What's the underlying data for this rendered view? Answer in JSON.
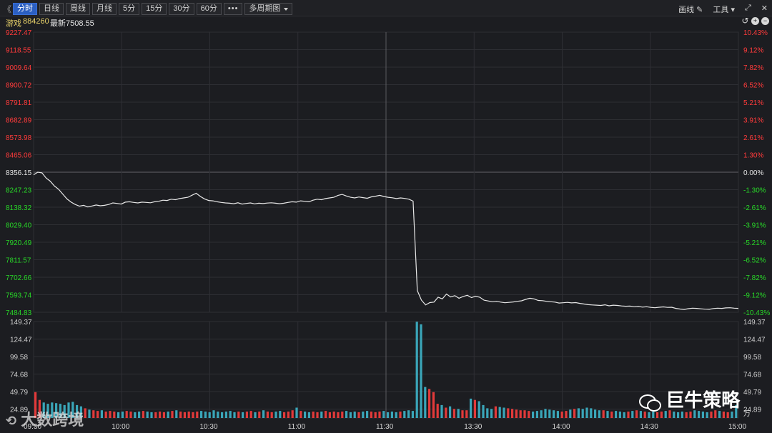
{
  "toolbar": {
    "nav_back": "《",
    "periods": [
      {
        "label": "分时",
        "active": true
      },
      {
        "label": "日线",
        "active": false
      },
      {
        "label": "周线",
        "active": false
      },
      {
        "label": "月线",
        "active": false
      },
      {
        "label": "5分",
        "active": false
      },
      {
        "label": "15分",
        "active": false
      },
      {
        "label": "30分",
        "active": false
      },
      {
        "label": "60分",
        "active": false
      }
    ],
    "more": "•••",
    "multi_period": "多周期图",
    "draw_line": "画线",
    "tools": "工具",
    "fullscreen_icon": "expand-icon",
    "close_icon": "close-icon"
  },
  "info": {
    "name": "游戏",
    "code": "884260",
    "latest": "最新7508.55"
  },
  "colors": {
    "up": "#ff3b3b",
    "down": "#28d728",
    "flat": "#e6e6e6",
    "vol_up": "#e23a3a",
    "vol_down": "#3aa6b9",
    "grid": "#2e2f34"
  },
  "price_axis": {
    "labels": [
      "9227.47",
      "9118.55",
      "9009.64",
      "8900.72",
      "8791.81",
      "8682.89",
      "8573.98",
      "8465.06",
      "8356.15",
      "8247.23",
      "8138.32",
      "8029.40",
      "7920.49",
      "7811.57",
      "7702.66",
      "7593.74",
      "7484.83"
    ],
    "pct_labels": [
      "10.43%",
      "9.12%",
      "7.82%",
      "6.52%",
      "5.21%",
      "3.91%",
      "2.61%",
      "1.30%",
      "0.00%",
      "-1.30%",
      "-2.61%",
      "-3.91%",
      "-5.21%",
      "-6.52%",
      "-7.82%",
      "-9.12%",
      "-10.43%"
    ],
    "mid_index": 8
  },
  "volume_axis": {
    "labels": [
      "149.37",
      "124.47",
      "99.58",
      "74.68",
      "49.79",
      "24.89"
    ],
    "unit": "万"
  },
  "time_axis": [
    "09:30",
    "10:00",
    "10:30",
    "11:00",
    "11:30",
    "13:30",
    "14:00",
    "14:30",
    "15:00"
  ],
  "watermarks": {
    "left": "大数跨境",
    "right": "巨牛策略"
  },
  "chart_data": {
    "type": "line",
    "x": [
      "09:30",
      "10:00",
      "10:30",
      "11:00",
      "11:30",
      "13:30",
      "14:00",
      "14:30",
      "15:00"
    ],
    "ylim": [
      7484.83,
      9227.47
    ],
    "base": 8356.15,
    "series": [
      {
        "values": [
          8340,
          8356,
          8352,
          8320,
          8300,
          8270,
          8250,
          8220,
          8190,
          8170,
          8155,
          8145,
          8150,
          8140,
          8146,
          8152,
          8147,
          8150,
          8155,
          8165,
          8162,
          8158,
          8170,
          8172,
          8168,
          8165,
          8170,
          8168,
          8166,
          8172,
          8175,
          8182,
          8180,
          8188,
          8185,
          8192,
          8196,
          8200,
          8213,
          8225,
          8205,
          8190,
          8180,
          8178,
          8172,
          8168,
          8165,
          8163,
          8160,
          8166,
          8158,
          8162,
          8165,
          8159,
          8163,
          8161,
          8164,
          8166,
          8163,
          8160,
          8163,
          8168,
          8172,
          8170,
          8178,
          8175,
          8172,
          8182,
          8188,
          8185,
          8192,
          8196,
          8200,
          8212,
          8218,
          8208,
          8200,
          8196,
          8202,
          8198,
          8194,
          8203,
          8207,
          8212,
          8205,
          8200,
          8197,
          8192,
          8196,
          8193,
          8188,
          8176,
          7620,
          7560,
          7530,
          7545,
          7548,
          7578,
          7568,
          7598,
          7580,
          7588,
          7572,
          7583,
          7590,
          7576,
          7585,
          7578,
          7560,
          7555,
          7550,
          7553,
          7548,
          7544,
          7546,
          7549,
          7553,
          7556,
          7565,
          7572,
          7568,
          7558,
          7557,
          7553,
          7550,
          7548,
          7542,
          7544,
          7546,
          7543,
          7545,
          7540,
          7536,
          7532,
          7530,
          7529,
          7527,
          7531,
          7525,
          7529,
          7527,
          7524,
          7522,
          7523,
          7519,
          7521,
          7517,
          7519,
          7515,
          7513,
          7516,
          7518,
          7515,
          7516,
          7509,
          7505,
          7502,
          7507,
          7510,
          7509,
          7506,
          7504,
          7503,
          7508,
          7510,
          7509,
          7512,
          7513,
          7510,
          7509
        ]
      }
    ],
    "volume": {
      "ylim": [
        0,
        149.37
      ],
      "values": [
        40,
        28,
        24,
        22,
        24,
        23,
        22,
        20,
        24,
        25,
        20,
        18,
        15,
        13,
        12,
        11,
        12,
        10,
        11,
        10,
        9,
        10,
        11,
        10,
        9,
        10,
        11,
        10,
        9,
        9,
        10,
        9,
        10,
        11,
        12,
        10,
        9,
        10,
        9,
        10,
        11,
        10,
        9,
        12,
        10,
        9,
        10,
        11,
        9,
        10,
        9,
        10,
        11,
        9,
        10,
        12,
        10,
        9,
        10,
        11,
        9,
        10,
        12,
        16,
        11,
        10,
        9,
        10,
        9,
        10,
        11,
        9,
        10,
        9,
        10,
        11,
        9,
        10,
        9,
        10,
        11,
        10,
        9,
        10,
        11,
        9,
        10,
        9,
        10,
        11,
        12,
        11,
        149,
        145,
        48,
        45,
        40,
        22,
        20,
        16,
        18,
        14,
        14,
        12,
        12,
        30,
        28,
        26,
        20,
        15,
        14,
        18,
        17,
        16,
        15,
        14,
        13,
        12,
        12,
        11,
        10,
        11,
        12,
        14,
        13,
        12,
        11,
        10,
        11,
        13,
        14,
        15,
        14,
        16,
        15,
        13,
        12,
        12,
        11,
        10,
        11,
        10,
        9,
        10,
        11,
        12,
        11,
        10,
        9,
        10,
        9,
        10,
        11,
        12,
        10,
        9,
        10,
        9,
        10,
        12,
        11,
        10,
        9,
        10,
        12,
        11,
        10,
        9,
        10,
        20
      ]
    }
  }
}
